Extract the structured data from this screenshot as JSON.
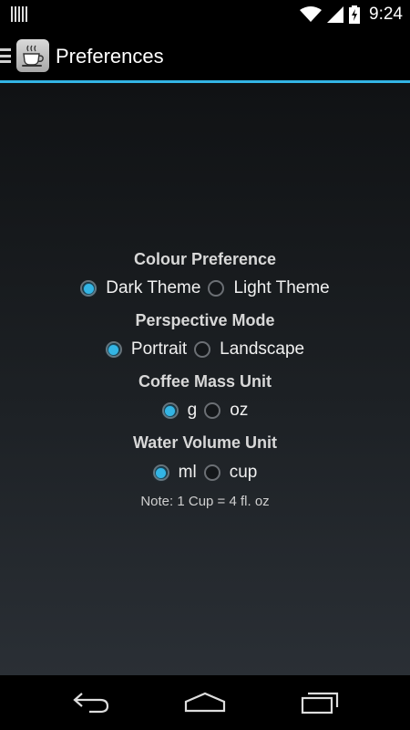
{
  "status_bar": {
    "time": "9:24",
    "icons": [
      "notification-bars-icon",
      "wifi-icon",
      "signal-icon",
      "battery-charging-icon"
    ]
  },
  "action_bar": {
    "title": "Preferences",
    "app_icon": "coffee-cup-icon",
    "drawer_icon": "drawer-indicator-icon"
  },
  "accent_color": "#33b5e5",
  "preferences": {
    "colour": {
      "title": "Colour Preference",
      "options": [
        {
          "label": "Dark Theme",
          "selected": true
        },
        {
          "label": "Light Theme",
          "selected": false
        }
      ]
    },
    "perspective": {
      "title": "Perspective Mode",
      "options": [
        {
          "label": "Portrait",
          "selected": true
        },
        {
          "label": "Landscape",
          "selected": false
        }
      ]
    },
    "coffee_mass": {
      "title": "Coffee Mass Unit",
      "options": [
        {
          "label": "g",
          "selected": true
        },
        {
          "label": "oz",
          "selected": false
        }
      ]
    },
    "water_volume": {
      "title": "Water Volume Unit",
      "options": [
        {
          "label": "ml",
          "selected": true
        },
        {
          "label": "cup",
          "selected": false
        }
      ]
    },
    "note": "Note: 1 Cup = 4 fl. oz"
  },
  "nav_bar": {
    "icons": [
      "back-icon",
      "home-icon",
      "recent-apps-icon"
    ]
  }
}
